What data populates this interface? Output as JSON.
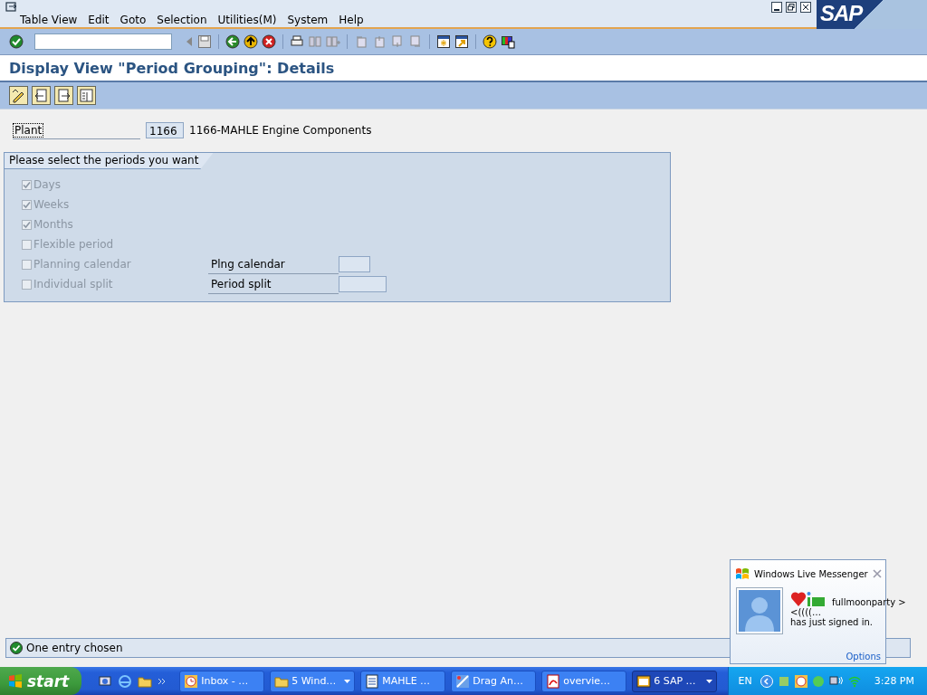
{
  "logo": "SAP",
  "menu": [
    {
      "label": "Table View"
    },
    {
      "label": "Edit"
    },
    {
      "label": "Goto"
    },
    {
      "label": "Selection"
    },
    {
      "label": "Utilities(M)"
    },
    {
      "label": "System"
    },
    {
      "label": "Help"
    }
  ],
  "title": "Display View \"Period Grouping\": Details",
  "plant": {
    "label": "Plant",
    "value": "1166",
    "description": "1166-MAHLE Engine Components"
  },
  "group": {
    "title": "Please select the periods you want",
    "options": [
      {
        "label": "Days",
        "checked": true,
        "disabled": true
      },
      {
        "label": "Weeks",
        "checked": true,
        "disabled": true
      },
      {
        "label": "Months",
        "checked": true,
        "disabled": true
      },
      {
        "label": "Flexible period",
        "checked": false,
        "disabled": true
      },
      {
        "label": "Planning calendar",
        "checked": false,
        "disabled": true,
        "field": {
          "label": "Plng calendar"
        }
      },
      {
        "label": "Individual split",
        "checked": false,
        "disabled": true,
        "field": {
          "label": "Period split"
        }
      }
    ]
  },
  "status": "One entry chosen",
  "messenger": {
    "title": "Windows Live Messenger",
    "name": "fullmoonparty >",
    "line2": "<((((…",
    "line3": "has just signed in.",
    "options": "Options"
  },
  "taskbar": {
    "start": "start",
    "tasks": [
      {
        "label": "Inbox - …",
        "grouped": false,
        "selected": false
      },
      {
        "label": "5 Wind…",
        "grouped": true,
        "selected": false
      },
      {
        "label": "MAHLE …",
        "grouped": false,
        "selected": false
      },
      {
        "label": "Drag An…",
        "grouped": false,
        "selected": false
      },
      {
        "label": "overvie…",
        "grouped": false,
        "selected": false
      },
      {
        "label": "6 SAP …",
        "grouped": true,
        "selected": true
      }
    ],
    "language": "EN",
    "clock": "3:28 PM"
  }
}
